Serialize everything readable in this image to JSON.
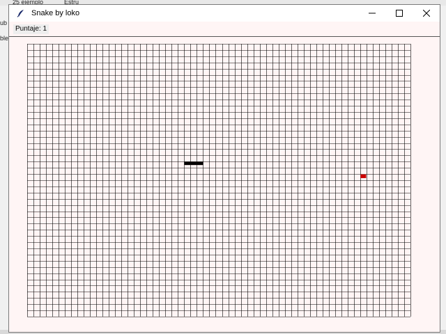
{
  "background": {
    "taskbar_texts": [
      "25 ejemplo",
      "Estru"
    ],
    "side_text": "ble",
    "side_text_top": "ub"
  },
  "window": {
    "title": "Snake by loko",
    "controls": {
      "minimize_icon": "minimize-icon",
      "maximize_icon": "maximize-icon",
      "close_icon": "close-icon"
    }
  },
  "status": {
    "score_label": "Puntaje: 1"
  },
  "game": {
    "columns": 61,
    "rows": 44,
    "snake_color": "#000000",
    "food_color": "#cc0000",
    "grid_color": "#000000",
    "board_color": "#fff5f5",
    "snake_cells": [
      [
        25,
        19
      ],
      [
        26,
        19
      ],
      [
        27,
        19
      ]
    ],
    "food_cell": [
      53,
      21
    ]
  }
}
